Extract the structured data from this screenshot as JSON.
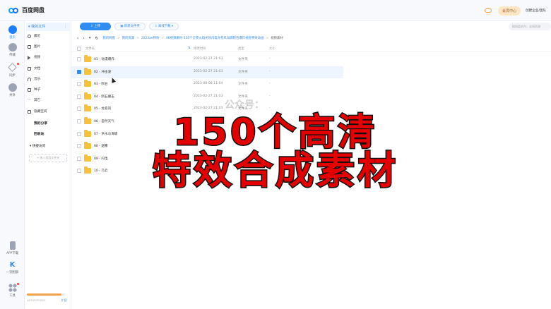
{
  "app": {
    "title": "百度网盘"
  },
  "topbar": {
    "vip_label": "会员中心",
    "team_label": "创建企业/团队",
    "game_icon": "gamepad-icon"
  },
  "rail": {
    "items": [
      {
        "label": "首页",
        "icon": "home-icon"
      },
      {
        "label": "传输",
        "icon": "transfer-icon"
      },
      {
        "label": "同步",
        "icon": "sync-icon"
      },
      {
        "label": "共享",
        "icon": "share-icon"
      }
    ],
    "bottom": [
      {
        "label": "APP下载",
        "icon": "phone-icon"
      },
      {
        "label": "一刻相册",
        "icon": "album-icon"
      },
      {
        "label": "工具",
        "icon": "tools-icon"
      }
    ]
  },
  "sidebar": {
    "my_files": "我的文件",
    "items": [
      "最近",
      "图片",
      "视频",
      "文档",
      "音乐",
      "种子",
      "其它",
      "隐藏空间"
    ],
    "my_share": "我的分享",
    "recycle": "回收站",
    "quick_access": "快捷访问",
    "add_quick": "+ 拖入常用文件夹",
    "storage_text": "1870G/2055G",
    "storage_expand": "扩容",
    "storage_fraction": 0.91
  },
  "toolbar": {
    "upload": "上传",
    "new_folder": "新建文件夹",
    "offline": "离线下载",
    "search_placeholder": "搜网盘文件，全网资源"
  },
  "breadcrumb": {
    "items": [
      "我的网盘",
      "我的资源",
      "2023ae特效",
      "4K视频素材-150个全景火焰光效闪电龙卷风海啸陨石爆炸视觉特效动画",
      "视频素材"
    ]
  },
  "table": {
    "headers": {
      "name": "文件名",
      "time": "修改时间",
      "type": "类型",
      "size": "大小"
    },
    "rows": [
      {
        "name": "01 - 动漫爆炸",
        "time": "2023-02-27 21:03",
        "type": "文件夹",
        "size": "-",
        "selected": false
      },
      {
        "name": "02 - 冲击波",
        "time": "2023-02-27 21:03",
        "type": "文件夹",
        "size": "-",
        "selected": true
      },
      {
        "name": "03 - 陨石",
        "time": "2023-08-08 11:04",
        "type": "文件夹",
        "size": "-",
        "selected": false
      },
      {
        "name": "04 - 陨石撞击",
        "time": "2023-02-27 21:03",
        "type": "文件夹",
        "size": "-",
        "selected": false
      },
      {
        "name": "05 - 龙卷风",
        "time": "2023-02-27 21:03",
        "type": "文件夹",
        "size": "-",
        "selected": false
      },
      {
        "name": "06 - 自然天气",
        "time": "",
        "type": "",
        "size": "",
        "selected": false
      },
      {
        "name": "07 - 洪水与海啸",
        "time": "",
        "type": "",
        "size": "",
        "selected": false
      },
      {
        "name": "08 - 烟雾",
        "time": "",
        "type": "",
        "size": "",
        "selected": false
      },
      {
        "name": "09 - 闪电",
        "time": "",
        "type": "",
        "size": "",
        "selected": false
      },
      {
        "name": "10 - 乌云",
        "time": "",
        "type": "",
        "size": "",
        "selected": false
      }
    ]
  },
  "overlay": {
    "line1": "150个高清",
    "line2": "特效合成素材",
    "color": "#e40000",
    "watermark": "公众号："
  }
}
